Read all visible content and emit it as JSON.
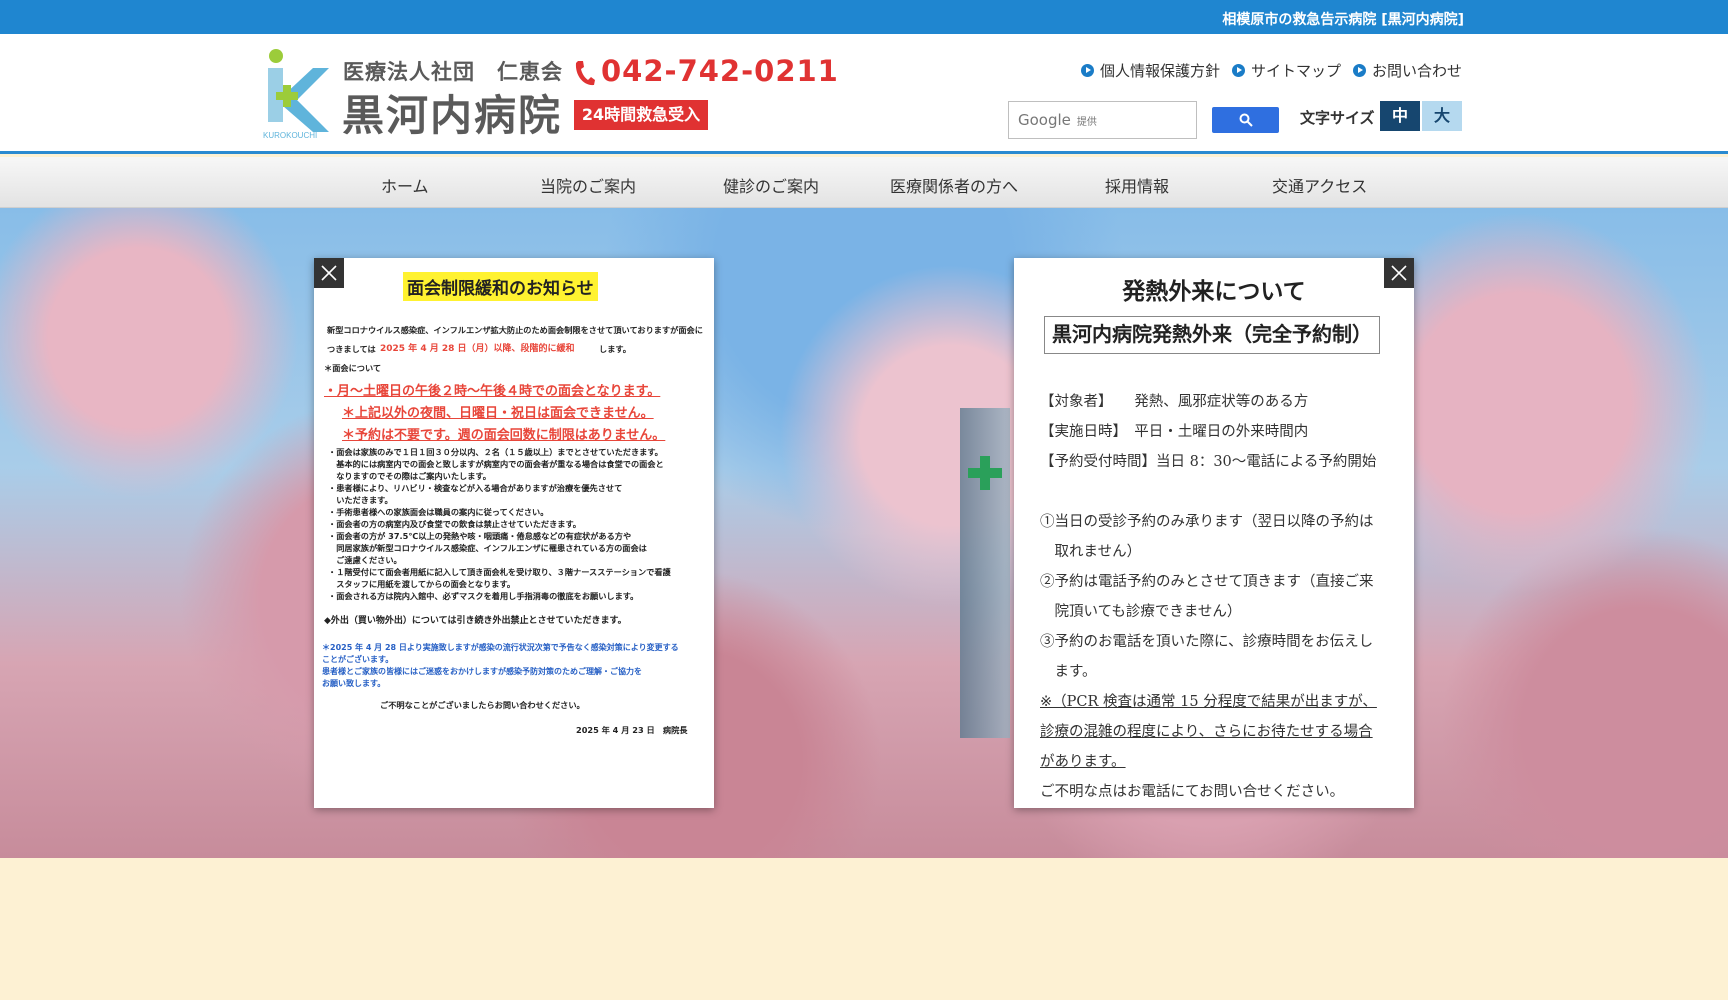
{
  "topbar": {
    "text": "相模原市の救急告示病院 [黒河内病院]"
  },
  "header": {
    "org": "医療法人社団　仁恵会",
    "hospital_name": "黒河内病院",
    "logo_caption": "KUROKOUCHI",
    "phone": "042-742-0211",
    "emergency_badge": "24時間救急受入",
    "links": [
      "個人情報保護方針",
      "サイトマップ",
      "お問い合わせ"
    ],
    "search": {
      "brand": "Google",
      "brand_sub": "提供"
    },
    "font_size_label": "文字サイズ",
    "font_size_options": [
      "中",
      "大"
    ]
  },
  "nav": [
    "ホーム",
    "当院のご案内",
    "健診のご案内",
    "医療関係者の方へ",
    "採用情報",
    "交通アクセス"
  ],
  "notice": {
    "title": "面会制限緩和のお知らせ",
    "intro_1": "新型コロナウイルス感染症、インフルエンザ拡大防止のため面会制限をさせて頂いておりますが面会に",
    "intro_2a": "つきましては",
    "intro_2b": "2025 年 4 月 28 日（月）以降、段階的に緩和",
    "intro_2c": "します。",
    "section": "＊面会について",
    "red_1": "・月～土曜日の午後２時～午後４時での面会となります。",
    "red_2": "＊上記以外の夜間、日曜日・祝日は面会できません。",
    "red_3": "＊予約は不要です。週の面会回数に制限はありません。",
    "rules": [
      "・面会は家族のみで１日１回３０分以内、２名（１５歳以上）までとさせていただきます。",
      "　基本的には病室内での面会と致しますが病室内での面会者が重なる場合は食堂での面会と",
      "　なりますのでその際はご案内いたします。",
      "・患者様により、リハビリ・検査などが入る場合がありますが治療を優先させて",
      "　いただきます。",
      "・手術患者様への家族面会は職員の案内に従ってください。",
      "・面会者の方の病室内及び食堂での飲食は禁止させていただきます。",
      "・面会者の方が 37.5℃以上の発熱や咳・咽頭痛・倦怠感などの有症状がある方や",
      "　同居家族が新型コロナウイルス感染症、インフルエンザに罹患されている方の面会は",
      "　ご遠慮ください。",
      "・１階受付にて面会者用紙に記入して頂き面会札を受け取り、３階ナースステーションで看護",
      "　スタッフに用紙を渡してからの面会となります。",
      "・面会される方は院内入館中、必ずマスクを着用し手指消毒の徹底をお願いします。"
    ],
    "outing": "◆外出（買い物外出）については引き続き外出禁止とさせていただきます。",
    "blue_notes": [
      "＊2025 年 4 月 28 日より実施致しますが感染の流行状況次第で予告なく感染対策により変更する",
      "ことがございます。",
      "患者様とご家族の皆様にはご迷惑をおかけしますが感染予防対策のためご理解・ご協力を",
      "お願い致します。"
    ],
    "contact": "ご不明なことがございましたらお問い合わせください。",
    "signature": "2025 年 4 月 23 日　病院長"
  },
  "fever": {
    "title": "発熱外来について",
    "box": "黒河内病院発熱外来（完全予約制）",
    "lines": [
      "【対象者】　　発熱、風邪症状等のある方",
      "【実施日時】　平日・土曜日の外来時間内",
      "【予約受付時間】当日 8：30～電話による予約開始",
      "①当日の受診予約のみ承ります（翌日以降の予約は",
      "　取れません）",
      "②予約は電話予約のみとさせて頂きます（直接ご来",
      "　院頂いても診療できません）",
      "③予約のお電話を頂いた際に、診療時間をお伝えし",
      "　ます。",
      "※（PCR 検査は通常 15 分程度で結果が出ますが、",
      "診療の混雑の程度により、さらにお待たせする場合",
      "があります。",
      "ご不明な点はお電話にてお問い合せください。"
    ]
  },
  "colors": {
    "topbar": "#1f86d0",
    "phone_red": "#e03232",
    "font_mid_active": "#16466f",
    "font_big": "#b5d9ef",
    "page_bg": "#fdf1d3"
  },
  "icons": [
    "phone-icon",
    "search-icon",
    "close-icon",
    "link-arrow-icon",
    "logo-k-icon"
  ]
}
